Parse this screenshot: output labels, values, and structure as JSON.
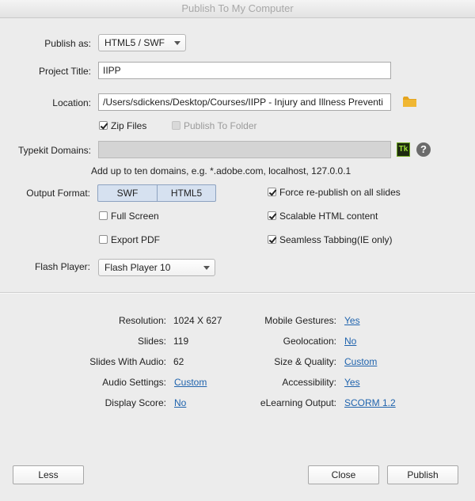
{
  "window": {
    "title": "Publish To My Computer"
  },
  "publish_as": {
    "label": "Publish as:",
    "value": "HTML5 / SWF"
  },
  "project_title": {
    "label": "Project Title:",
    "value": "IIPP"
  },
  "location": {
    "label": "Location:",
    "value": "/Users/sdickens/Desktop/Courses/IIPP - Injury and Illness Preventi"
  },
  "zip_files": {
    "label": "Zip Files",
    "checked": true
  },
  "publish_to_folder": {
    "label": "Publish To Folder",
    "checked": false,
    "enabled": false
  },
  "typekit": {
    "label": "Typekit Domains:",
    "value": "",
    "hint": "Add up to ten domains, e.g. *.adobe.com, localhost, 127.0.0.1",
    "tk_icon_text": "Tk",
    "help_icon_text": "?"
  },
  "output_format": {
    "label": "Output Format:",
    "swf": "SWF",
    "html5": "HTML5"
  },
  "options_left": [
    {
      "label": "Full Screen",
      "checked": false
    },
    {
      "label": "Export PDF",
      "checked": false
    }
  ],
  "options_right": [
    {
      "label": "Force re-publish on all slides",
      "checked": true
    },
    {
      "label": "Scalable HTML content",
      "checked": true
    },
    {
      "label": "Seamless Tabbing(IE only)",
      "checked": true
    }
  ],
  "flash_player": {
    "label": "Flash Player:",
    "value": "Flash Player 10"
  },
  "summary_left": [
    {
      "label": "Resolution:",
      "value": "1024 X 627",
      "link": false
    },
    {
      "label": "Slides:",
      "value": "119",
      "link": false
    },
    {
      "label": "Slides With Audio:",
      "value": "62",
      "link": false
    },
    {
      "label": "Audio Settings:",
      "value": "Custom",
      "link": true
    },
    {
      "label": "Display Score:",
      "value": "No",
      "link": true
    }
  ],
  "summary_right": [
    {
      "label": "Mobile Gestures:",
      "value": "Yes"
    },
    {
      "label": "Geolocation:",
      "value": "No"
    },
    {
      "label": "Size & Quality:",
      "value": "Custom"
    },
    {
      "label": "Accessibility:",
      "value": "Yes"
    },
    {
      "label": "eLearning Output:",
      "value": "SCORM 1.2"
    }
  ],
  "buttons": {
    "less": "Less",
    "close": "Close",
    "publish": "Publish"
  },
  "colors": {
    "link": "#1f63ad",
    "segment_selected": "#d6e1f0",
    "background": "#ececec"
  }
}
